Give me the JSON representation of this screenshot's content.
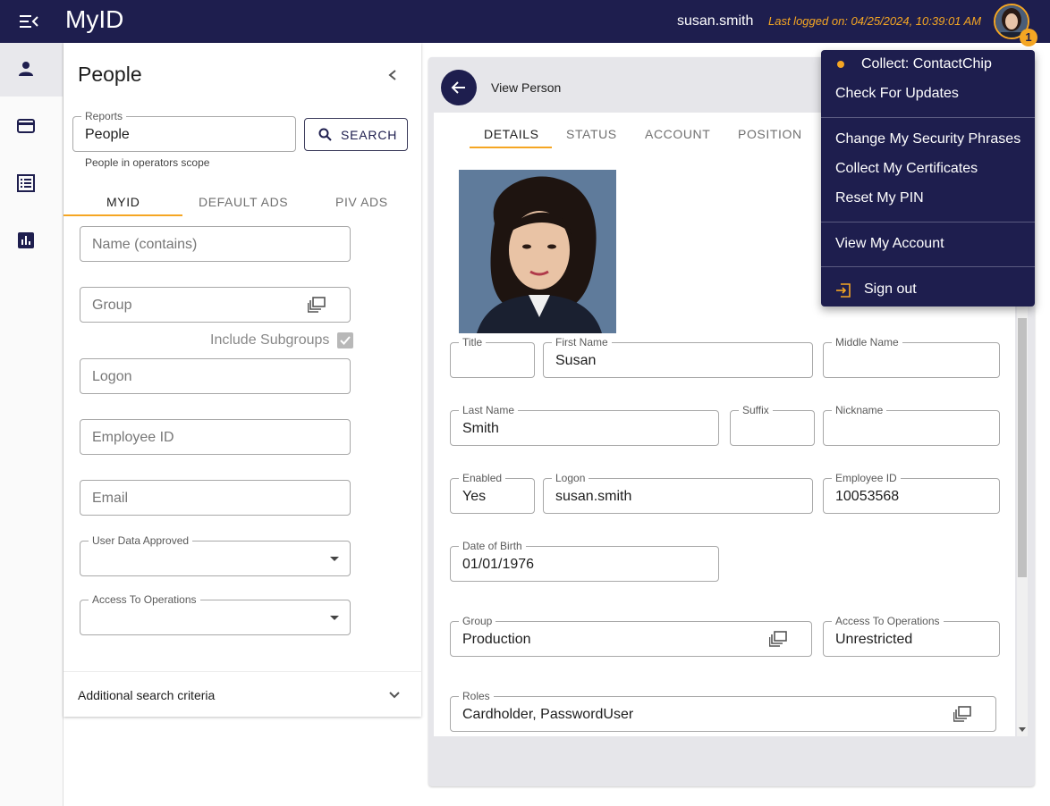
{
  "header": {
    "app_title": "MyID",
    "username": "susan.smith",
    "last_logged": "Last logged on: 04/25/2024, 10:39:01 AM",
    "notification_count": "1"
  },
  "rail": {
    "items": [
      "person-icon",
      "card-icon",
      "list-icon",
      "chart-icon"
    ]
  },
  "people": {
    "title": "People",
    "reports_label": "Reports",
    "reports_value": "People",
    "search_label": "SEARCH",
    "scope_text": "People in operators scope",
    "tabs": [
      "MYID",
      "DEFAULT ADS",
      "PIV ADS"
    ],
    "active_tab": "MYID",
    "name_placeholder": "Name (contains)",
    "group_placeholder": "Group",
    "include_subgroups": "Include Subgroups",
    "logon_placeholder": "Logon",
    "employee_id_placeholder": "Employee ID",
    "email_placeholder": "Email",
    "user_data_approved_label": "User Data Approved",
    "access_label": "Access To Operations",
    "additional_criteria": "Additional search criteria"
  },
  "detail": {
    "view_title": "View Person",
    "tabs": [
      "DETAILS",
      "STATUS",
      "ACCOUNT",
      "POSITION"
    ],
    "active_tab": "DETAILS",
    "fields": {
      "title": {
        "label": "Title",
        "value": ""
      },
      "first_name": {
        "label": "First Name",
        "value": "Susan"
      },
      "middle_name": {
        "label": "Middle Name",
        "value": ""
      },
      "last_name": {
        "label": "Last Name",
        "value": "Smith"
      },
      "suffix": {
        "label": "Suffix",
        "value": ""
      },
      "nickname": {
        "label": "Nickname",
        "value": ""
      },
      "enabled": {
        "label": "Enabled",
        "value": "Yes"
      },
      "logon": {
        "label": "Logon",
        "value": "susan.smith"
      },
      "employee_id": {
        "label": "Employee ID",
        "value": "10053568"
      },
      "dob": {
        "label": "Date of Birth",
        "value": "01/01/1976"
      },
      "group": {
        "label": "Group",
        "value": "Production"
      },
      "access": {
        "label": "Access To Operations",
        "value": "Unrestricted"
      },
      "roles": {
        "label": "Roles",
        "value": "Cardholder, PasswordUser"
      }
    }
  },
  "user_menu": {
    "collect": "Collect: ContactChip",
    "check_updates": "Check For Updates",
    "change_phrases": "Change My Security Phrases",
    "collect_certs": "Collect My Certificates",
    "reset_pin": "Reset My PIN",
    "view_account": "View My Account",
    "sign_out": "Sign out"
  },
  "colors": {
    "primary": "#1e1e4e",
    "accent": "#f5a623"
  }
}
